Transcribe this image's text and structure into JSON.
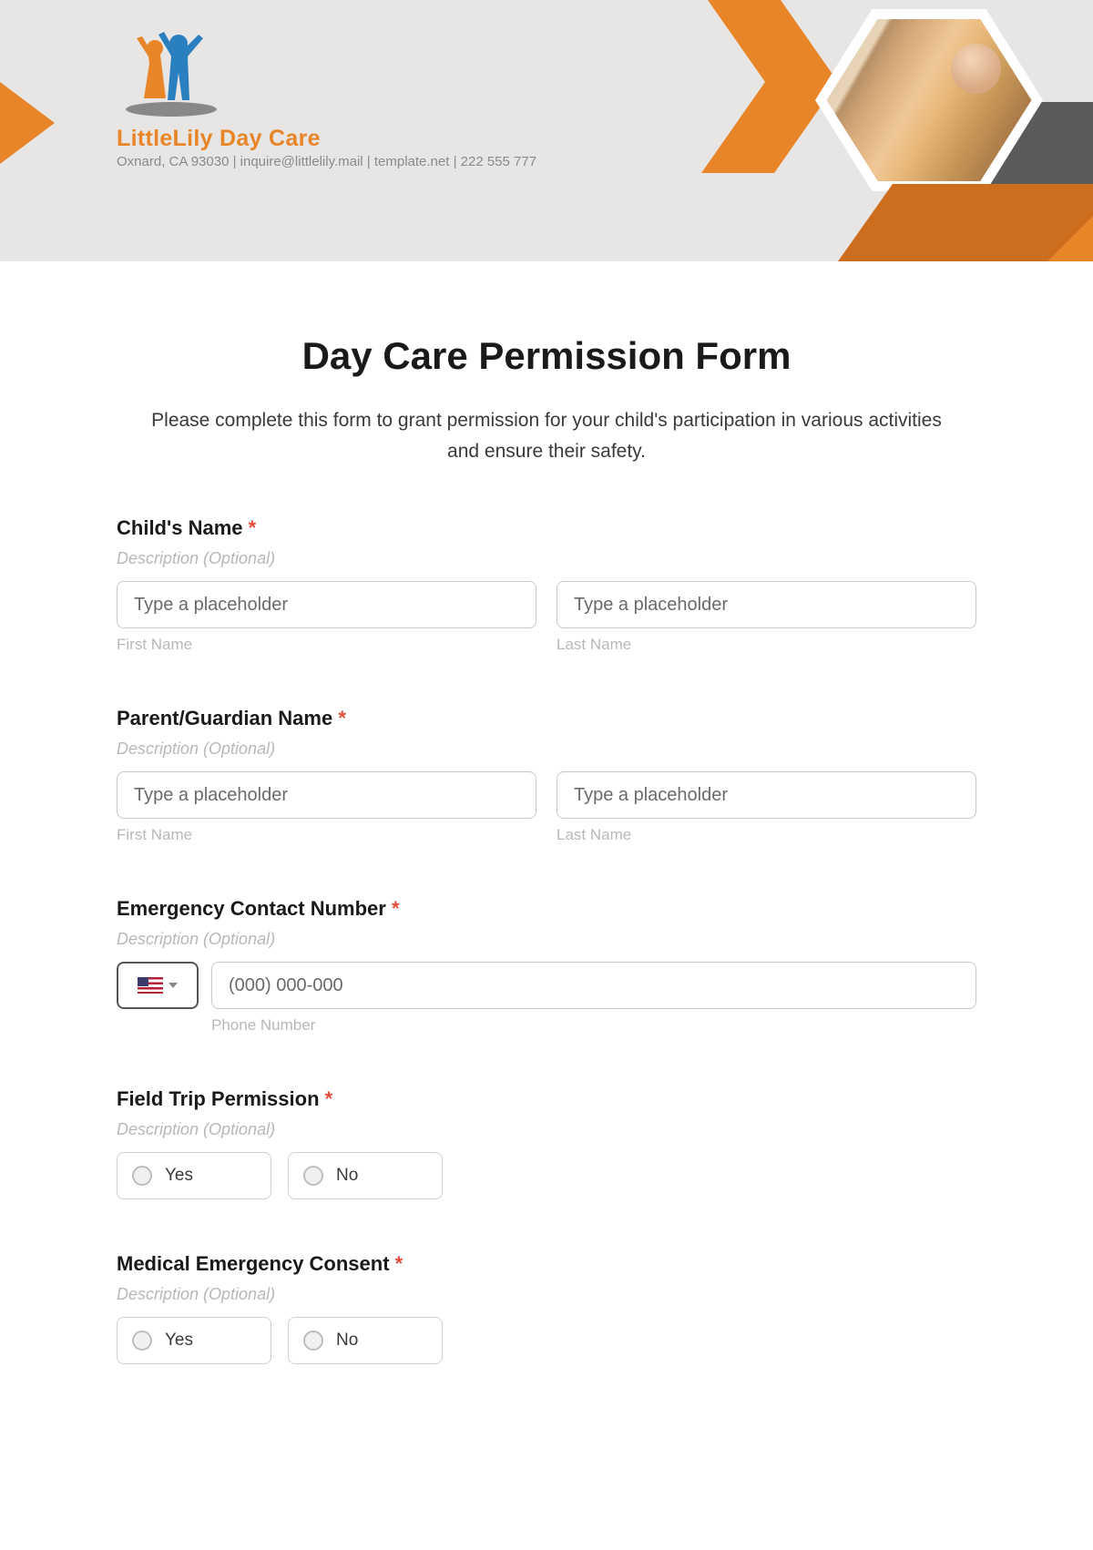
{
  "brand": {
    "name": "LittleLily Day Care",
    "sub": "Oxnard, CA 93030 | inquire@littlelily.mail | template.net | 222 555 777"
  },
  "page": {
    "title": "Day Care Permission Form",
    "intro": "Please complete this form to grant permission for your child's participation in various activities and ensure their safety."
  },
  "labels": {
    "required_mark": "*",
    "desc_placeholder": "Description (Optional)",
    "first_name": "First Name",
    "last_name": "Last Name",
    "phone_number": "Phone Number"
  },
  "fields": {
    "child_name": {
      "label": "Child's Name",
      "first_placeholder": "Type a placeholder",
      "last_placeholder": "Type a placeholder"
    },
    "parent_name": {
      "label": "Parent/Guardian Name",
      "first_placeholder": "Type a placeholder",
      "last_placeholder": "Type a placeholder"
    },
    "emergency": {
      "label": "Emergency Contact Number",
      "phone_placeholder": "(000) 000-000"
    },
    "field_trip": {
      "label": "Field Trip Permission",
      "yes": "Yes",
      "no": "No"
    },
    "medical": {
      "label": "Medical Emergency Consent",
      "yes": "Yes",
      "no": "No"
    }
  }
}
